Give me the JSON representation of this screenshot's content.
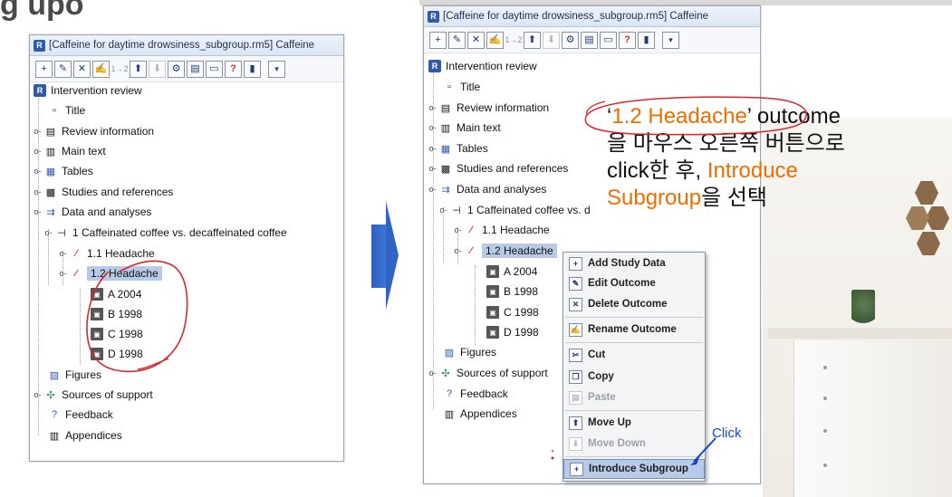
{
  "slide": {
    "title": "g upo"
  },
  "left_window": {
    "title": "[Caffeine for daytime drowsiness_subgroup.rm5] Caffeine",
    "toolbar": {
      "text_button": "1→2"
    },
    "tree": [
      {
        "label": "Intervention review"
      },
      {
        "label": "Title"
      },
      {
        "label": "Review information"
      },
      {
        "label": "Main text"
      },
      {
        "label": "Tables"
      },
      {
        "label": "Studies and references"
      },
      {
        "label": "Data and analyses"
      },
      {
        "label": "1 Caffeinated coffee vs. decaffeinated coffee"
      },
      {
        "label": "1.1 Headache"
      },
      {
        "label": "1.2 Headache"
      },
      {
        "label": "A 2004"
      },
      {
        "label": "B 1998"
      },
      {
        "label": "C 1998"
      },
      {
        "label": "D 1998"
      },
      {
        "label": "Figures"
      },
      {
        "label": "Sources of support"
      },
      {
        "label": "Feedback"
      },
      {
        "label": "Appendices"
      }
    ]
  },
  "right_window": {
    "title": "[Caffeine for daytime drowsiness_subgroup.rm5] Caffeine",
    "toolbar": {
      "text_button": "1→2"
    },
    "tree": [
      {
        "label": "Intervention review"
      },
      {
        "label": "Title"
      },
      {
        "label": "Review information"
      },
      {
        "label": "Main text"
      },
      {
        "label": "Tables"
      },
      {
        "label": "Studies and references"
      },
      {
        "label": "Data and analyses"
      },
      {
        "label": "1 Caffeinated coffee vs. d"
      },
      {
        "label": "1.1 Headache"
      },
      {
        "label": "1.2 Headache"
      },
      {
        "label": "A 2004"
      },
      {
        "label": "B 1998"
      },
      {
        "label": "C 1998"
      },
      {
        "label": "D 1998"
      },
      {
        "label": "Figures"
      },
      {
        "label": "Sources of support"
      },
      {
        "label": "Feedback"
      },
      {
        "label": "Appendices"
      }
    ]
  },
  "context_menu": {
    "items": [
      {
        "label": "Add Study Data",
        "enabled": true
      },
      {
        "label": "Edit Outcome",
        "enabled": true
      },
      {
        "label": "Delete Outcome",
        "enabled": true
      },
      {
        "label": "Rename Outcome",
        "enabled": true
      },
      {
        "label": "Cut",
        "enabled": true
      },
      {
        "label": "Copy",
        "enabled": true
      },
      {
        "label": "Paste",
        "enabled": false
      },
      {
        "label": "Move Up",
        "enabled": true
      },
      {
        "label": "Move Down",
        "enabled": false
      },
      {
        "label": "Introduce Subgroup",
        "enabled": true,
        "highlighted": true
      }
    ]
  },
  "annotation": {
    "quote_open": "‘",
    "outcome_name": "1.2 Headache",
    "line1_rest": "’ outcome",
    "line2": "을 마우스 오른쪽 버튼으로",
    "line3_prefix": "click한 후, ",
    "line3_orange": "Introduce",
    "line4_orange": "Subgroup",
    "line4_rest": "을 선택",
    "click_label": "Click"
  },
  "colors": {
    "accent_orange": "#ee6d00",
    "pen_red": "#d8262e",
    "click_blue": "#1346c4",
    "selection": "#b8cbe6"
  }
}
